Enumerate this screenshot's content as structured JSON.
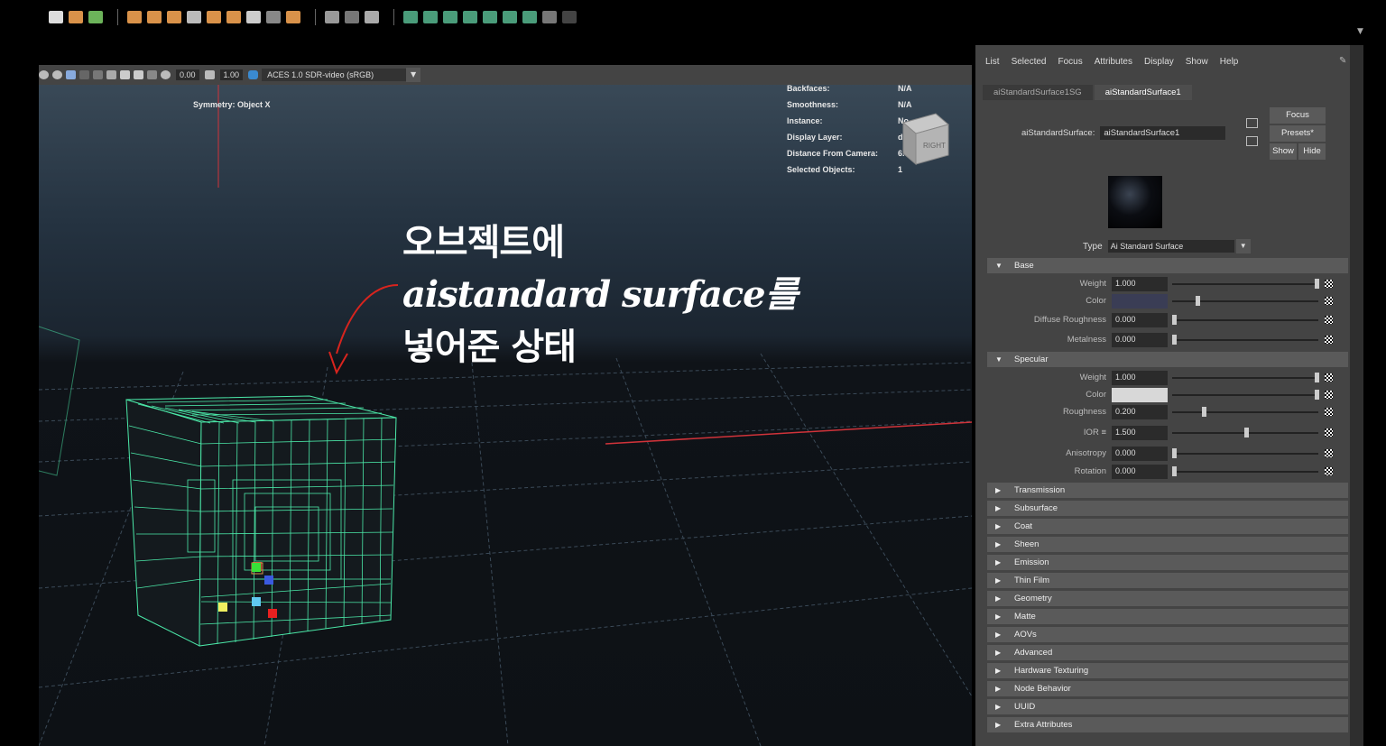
{
  "viewport_toolbar": {
    "field1": "0.00",
    "field2": "1.00",
    "colorspace": "ACES 1.0 SDR-video (sRGB)"
  },
  "hud": {
    "symmetry": "Symmetry: Object X",
    "rows": [
      {
        "label": "Backfaces:",
        "value": "N/A"
      },
      {
        "label": "Smoothness:",
        "value": "N/A"
      },
      {
        "label": "Instance:",
        "value": "No"
      },
      {
        "label": "Display Layer:",
        "value": "default"
      },
      {
        "label": "Distance From Camera:",
        "value": "6.958"
      },
      {
        "label": "Selected Objects:",
        "value": "1"
      }
    ]
  },
  "viewcube_label": "RIGHT",
  "callout": {
    "line1": "오브젝트에",
    "line2": "aistandard surface를",
    "line3": "넣어준 상태"
  },
  "panel": {
    "menu": [
      "List",
      "Selected",
      "Focus",
      "Attributes",
      "Display",
      "Show",
      "Help"
    ],
    "tabs": [
      "aiStandardSurface1SG",
      "aiStandardSurface1"
    ],
    "node_label": "aiStandardSurface:",
    "node_value": "aiStandardSurface1",
    "focus_btn": "Focus",
    "presets_btn": "Presets*",
    "show_btn": "Show",
    "hide_btn": "Hide",
    "type_label": "Type",
    "type_value": "Ai Standard Surface",
    "base_section": "Base",
    "base_attrs": [
      {
        "label": "Weight",
        "value": "1.000",
        "slider": 1.0
      },
      {
        "label": "Color",
        "value": "",
        "slider": 0.2
      },
      {
        "label": "Diffuse Roughness",
        "value": "0.000",
        "slider": 0.0
      },
      {
        "label": "Metalness",
        "value": "0.000",
        "slider": 0.0
      }
    ],
    "specular_section": "Specular",
    "specular_attrs": [
      {
        "label": "Weight",
        "value": "1.000",
        "slider": 1.0
      },
      {
        "label": "Color",
        "value": "",
        "slider": 1.0
      },
      {
        "label": "Roughness",
        "value": "0.200",
        "slider": 0.2
      },
      {
        "label": "IOR ≡",
        "value": "1.500",
        "slider": 0.5
      },
      {
        "label": "Anisotropy",
        "value": "0.000",
        "slider": 0.0
      },
      {
        "label": "Rotation",
        "value": "0.000",
        "slider": 0.0
      }
    ],
    "collapsed_sections": [
      "Transmission",
      "Subsurface",
      "Coat",
      "Sheen",
      "Emission",
      "Thin Film",
      "Geometry",
      "Matte",
      "AOVs",
      "Advanced",
      "Hardware Texturing",
      "Node Behavior",
      "UUID",
      "Extra Attributes"
    ]
  },
  "colors": {
    "wire": "#4be8a8",
    "base_color": "#3a3d55",
    "spec_color": "#d8d8d8",
    "accent": "#e84b3b"
  }
}
